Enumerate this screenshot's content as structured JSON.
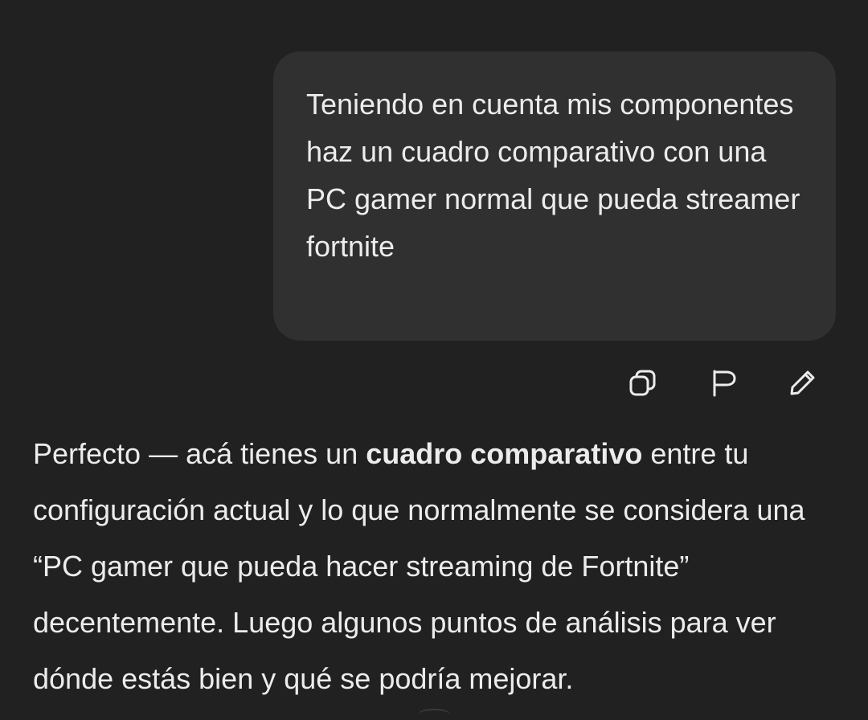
{
  "user_message": {
    "text": "Teniendo en cuenta mis componentes haz un cuadro comparativo con una PC gamer normal que pueda streamer fortnite"
  },
  "message_actions": [
    {
      "icon": "copy-icon"
    },
    {
      "icon": "flag-icon"
    },
    {
      "icon": "pencil-icon"
    }
  ],
  "assistant_message": {
    "text_before": "Perfecto — acá tienes un ",
    "bold": "cuadro comparativo",
    "text_after": " entre tu configuración actual y lo que normalmente se considera una “PC gamer que pueda hacer streaming de Fortnite” decentemente. Luego algunos puntos de análisis para ver dónde estás bien y qué se podría mejorar."
  },
  "colors": {
    "background": "#212121",
    "user_bubble": "#303030",
    "text": "#ececec",
    "icon": "#ececec"
  }
}
